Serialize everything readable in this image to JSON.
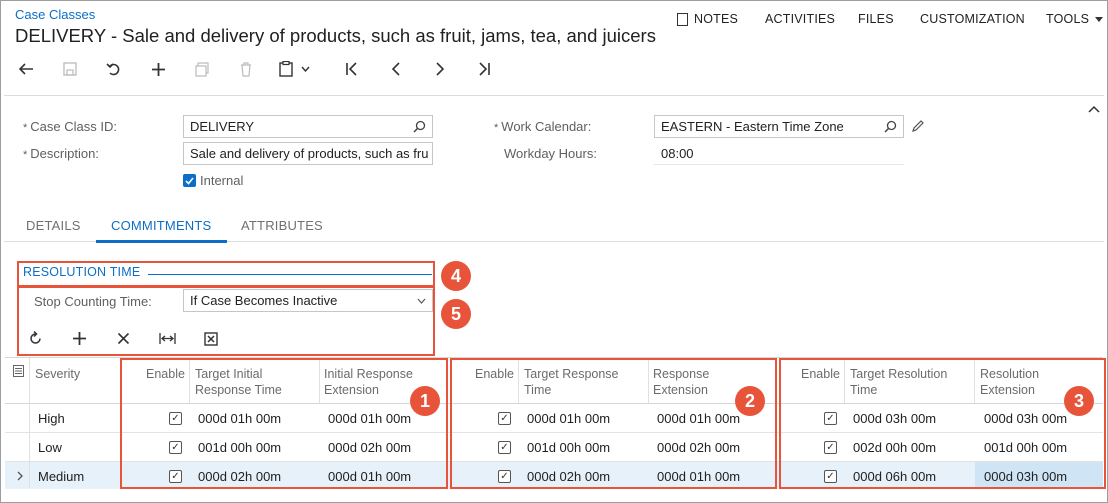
{
  "breadcrumb": "Case Classes",
  "title": "DELIVERY - Sale and delivery of products, such as fruit, jams, tea, and juicers",
  "topnav": {
    "notes": "NOTES",
    "activities": "ACTIVITIES",
    "files": "FILES",
    "customization": "CUSTOMIZATION",
    "tools": "TOOLS"
  },
  "form": {
    "case_class_id_label": "Case Class ID:",
    "case_class_id_value": "DELIVERY",
    "description_label": "Description:",
    "description_value": "Sale and delivery of products, such as fru",
    "internal_label": "Internal",
    "work_calendar_label": "Work Calendar:",
    "work_calendar_value": "EASTERN - Eastern Time Zone",
    "workday_hours_label": "Workday Hours:",
    "workday_hours_value": "08:00",
    "required_mark": "*"
  },
  "tabs": [
    "DETAILS",
    "COMMITMENTS",
    "ATTRIBUTES"
  ],
  "section": {
    "title": "RESOLUTION TIME",
    "stop_label": "Stop Counting Time:",
    "stop_value": "If Case Becomes Inactive"
  },
  "grid": {
    "headers": {
      "severity": "Severity",
      "enable": "Enable",
      "target_initial_1": "Target Initial",
      "target_initial_2": "Response Time",
      "initial_ext_1": "Initial Response",
      "initial_ext_2": "Extension",
      "target_response_1": "Target Response",
      "target_response_2": "Time",
      "response_ext_1": "Response",
      "response_ext_2": "Extension",
      "target_resolution_1": "Target Resolution",
      "target_resolution_2": "Time",
      "resolution_ext_1": "Resolution",
      "resolution_ext_2": "Extension"
    },
    "rows": [
      {
        "severity": "High",
        "tirt": "000d 01h 00m",
        "ire": "000d 01h 00m",
        "trt": "000d 01h 00m",
        "re": "000d 01h 00m",
        "tres": "000d 03h 00m",
        "rese": "000d 03h 00m"
      },
      {
        "severity": "Low",
        "tirt": "001d 00h 00m",
        "ire": "000d 02h 00m",
        "trt": "001d 00h 00m",
        "re": "000d 02h 00m",
        "tres": "002d 00h 00m",
        "rese": "001d 00h 00m"
      },
      {
        "severity": "Medium",
        "tirt": "000d 02h 00m",
        "ire": "000d 01h 00m",
        "trt": "000d 02h 00m",
        "re": "000d 01h 00m",
        "tres": "000d 06h 00m",
        "rese": "000d 03h 00m"
      }
    ]
  },
  "badges": [
    "1",
    "2",
    "3",
    "4",
    "5"
  ],
  "colors": {
    "accent": "#0c6ec6",
    "callout": "#e8543a",
    "selected_row": "#e6f1fa",
    "selected_cell": "#cfe5f6"
  }
}
